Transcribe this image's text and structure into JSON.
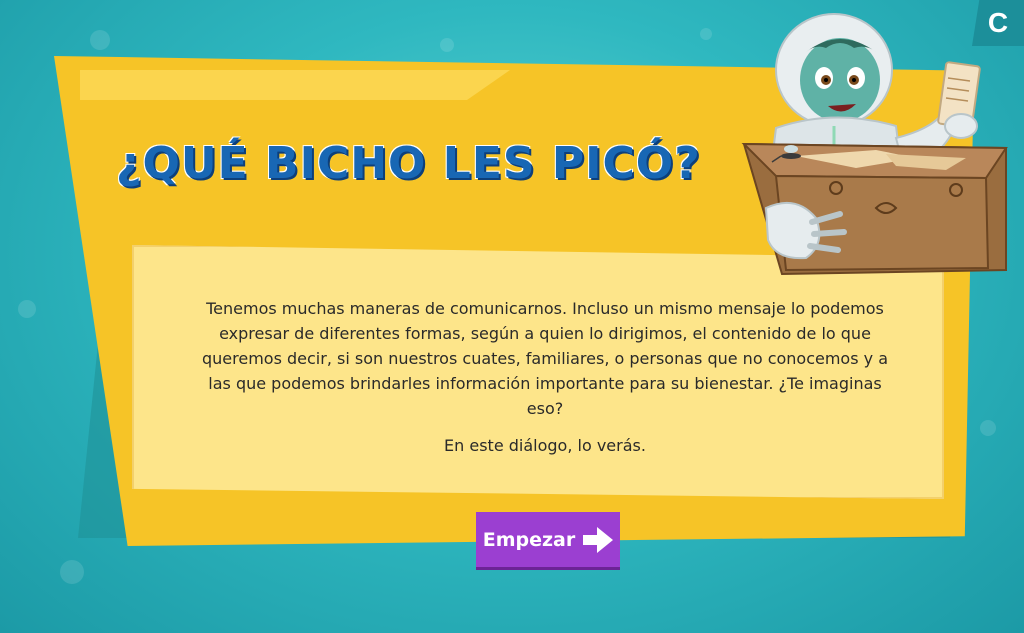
{
  "corner_badge": {
    "label": "C"
  },
  "title": "¿QUÉ BICHO LES PICÓ?",
  "description": {
    "paragraph_1": "Tenemos muchas maneras de comunicarnos. Incluso un mismo mensaje lo podemos expresar de diferentes formas, según a quien lo dirigimos, el contenido de lo que queremos decir, si son nuestros cuates, familiares, o personas que no conocemos y a las que podemos brindarles información importante para su bienestar. ¿Te imaginas eso?",
    "paragraph_2": "En este diálogo, lo verás."
  },
  "start_button": {
    "label": "Empezar",
    "icon": "arrow-right-icon"
  },
  "illustration": {
    "name": "character-in-hazmat-suit-with-box"
  },
  "colors": {
    "background": "#2fb8c0",
    "card": "#f6c427",
    "panel": "#fde58a",
    "title": "#1867b4",
    "button": "#9b3fd1"
  }
}
